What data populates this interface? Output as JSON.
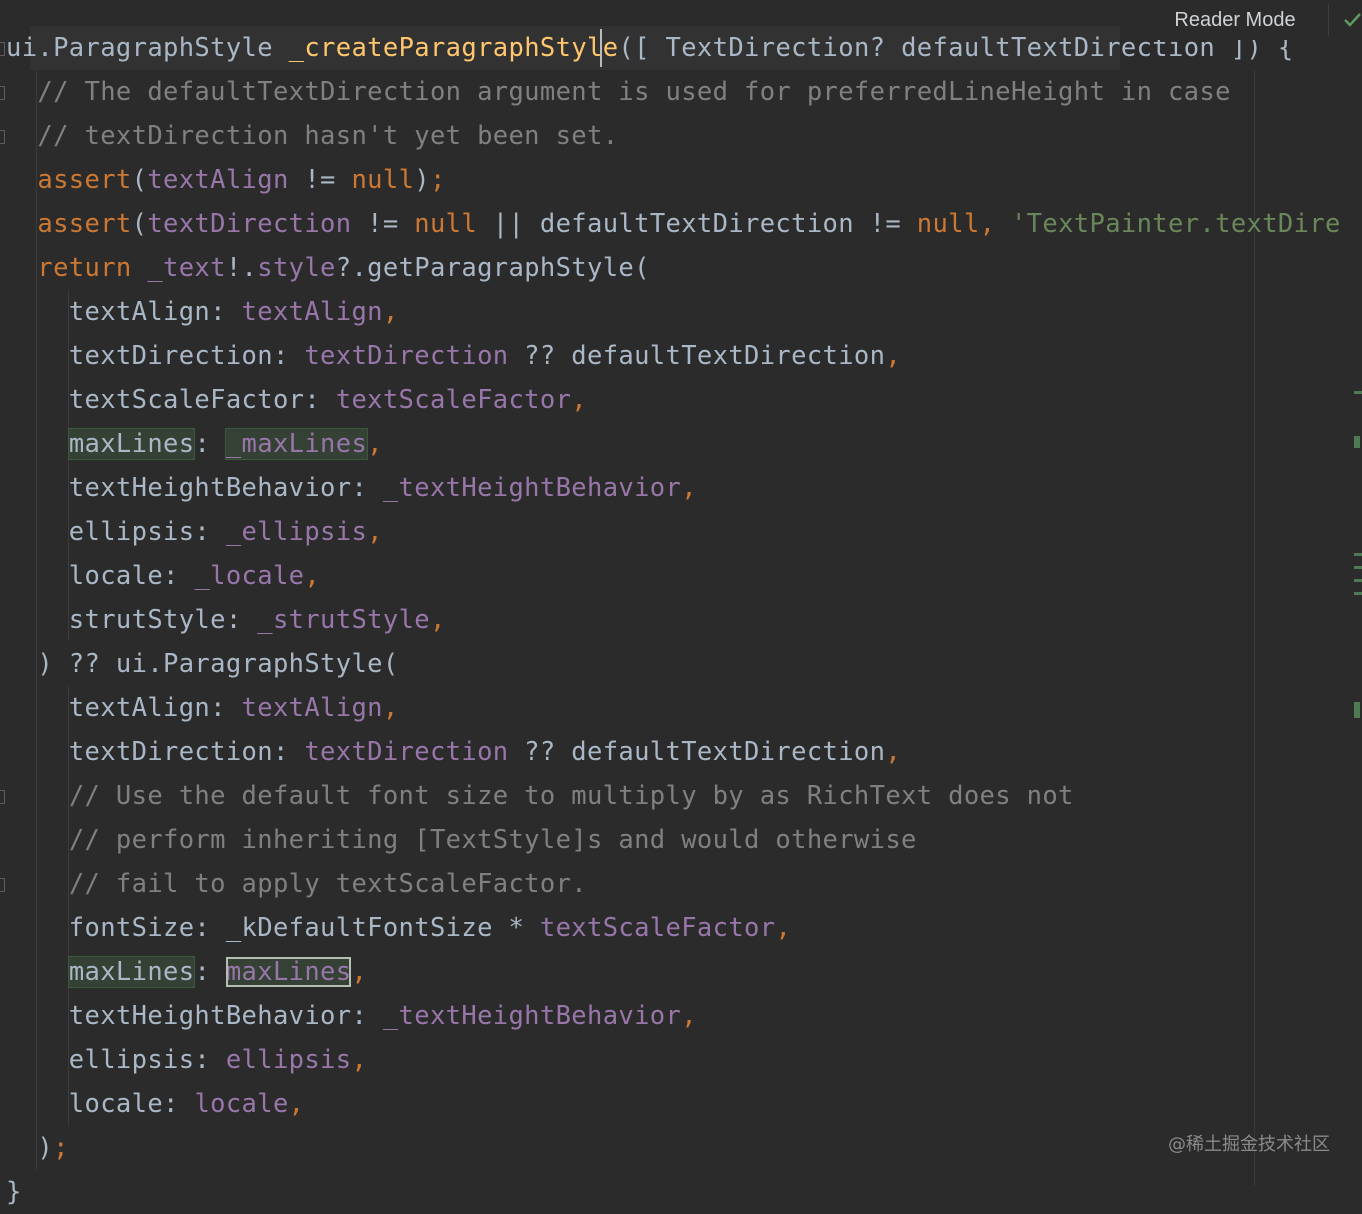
{
  "header": {
    "reader_mode_label": "Reader Mode"
  },
  "watermark": "@稀土掘金技术社区",
  "code_lines": [
    [
      [
        "default",
        "ui.ParagraphStyle "
      ],
      [
        "method",
        "_createParagraphSt"
      ],
      [
        "method",
        "yle"
      ],
      [
        "default",
        "([ TextDirection? defaultTextDirection ]) {"
      ]
    ],
    [
      [
        "default",
        "  "
      ],
      [
        "comment",
        "// The defaultTextDirection argument is used for preferredLineHeight in case"
      ]
    ],
    [
      [
        "default",
        "  "
      ],
      [
        "comment",
        "// textDirection hasn't yet been set."
      ]
    ],
    [
      [
        "default",
        "  "
      ],
      [
        "keyword",
        "assert"
      ],
      [
        "default",
        "("
      ],
      [
        "field",
        "textAlign"
      ],
      [
        "default",
        " != "
      ],
      [
        "keyword",
        "null"
      ],
      [
        "default",
        ")"
      ],
      [
        "punct",
        ";"
      ]
    ],
    [
      [
        "default",
        "  "
      ],
      [
        "keyword",
        "assert"
      ],
      [
        "default",
        "("
      ],
      [
        "field",
        "textDirection"
      ],
      [
        "default",
        " != "
      ],
      [
        "keyword",
        "null"
      ],
      [
        "default",
        " || defaultTextDirection != "
      ],
      [
        "keyword",
        "null"
      ],
      [
        "punct",
        ","
      ],
      [
        "default",
        " "
      ],
      [
        "string",
        "'TextPainter.textDire"
      ]
    ],
    [
      [
        "default",
        "  "
      ],
      [
        "keyword",
        "return"
      ],
      [
        "default",
        " "
      ],
      [
        "field",
        "_text"
      ],
      [
        "default",
        "!."
      ],
      [
        "field",
        "style"
      ],
      [
        "default",
        "?.getParagraphStyle("
      ]
    ],
    [
      [
        "default",
        "    textAlign: "
      ],
      [
        "field",
        "textAlign"
      ],
      [
        "punct",
        ","
      ]
    ],
    [
      [
        "default",
        "    textDirection: "
      ],
      [
        "field",
        "textDirection"
      ],
      [
        "default",
        " ?? defaultTextDirection"
      ],
      [
        "punct",
        ","
      ]
    ],
    [
      [
        "default",
        "    textScaleFactor: "
      ],
      [
        "field",
        "textScaleFactor"
      ],
      [
        "punct",
        ","
      ]
    ],
    [
      [
        "default",
        "    "
      ],
      [
        "default hl-green",
        "maxLines"
      ],
      [
        "default",
        ": "
      ],
      [
        "field hl-green",
        "_maxLines"
      ],
      [
        "punct",
        ","
      ]
    ],
    [
      [
        "default",
        "    textHeightBehavior: "
      ],
      [
        "field",
        "_textHeightBehavior"
      ],
      [
        "punct",
        ","
      ]
    ],
    [
      [
        "default",
        "    ellipsis: "
      ],
      [
        "field",
        "_ellipsis"
      ],
      [
        "punct",
        ","
      ]
    ],
    [
      [
        "default",
        "    locale: "
      ],
      [
        "field",
        "_locale"
      ],
      [
        "punct",
        ","
      ]
    ],
    [
      [
        "default",
        "    strutStyle: "
      ],
      [
        "field",
        "_strutStyle"
      ],
      [
        "punct",
        ","
      ]
    ],
    [
      [
        "default",
        "  ) ?? ui.ParagraphStyle("
      ]
    ],
    [
      [
        "default",
        "    textAlign: "
      ],
      [
        "field",
        "textAlign"
      ],
      [
        "punct",
        ","
      ]
    ],
    [
      [
        "default",
        "    textDirection: "
      ],
      [
        "field",
        "textDirection"
      ],
      [
        "default",
        " ?? defaultTextDirection"
      ],
      [
        "punct",
        ","
      ]
    ],
    [
      [
        "default",
        "    "
      ],
      [
        "comment",
        "// Use the default font size to multiply by as RichText does not"
      ]
    ],
    [
      [
        "default",
        "    "
      ],
      [
        "comment",
        "// perform inheriting [TextStyle]s and would otherwise"
      ]
    ],
    [
      [
        "default",
        "    "
      ],
      [
        "comment",
        "// fail to apply textScaleFactor."
      ]
    ],
    [
      [
        "default",
        "    fontSize: _kDefaultFontSize * "
      ],
      [
        "field",
        "textScaleFactor"
      ],
      [
        "punct",
        ","
      ]
    ],
    [
      [
        "default",
        "    "
      ],
      [
        "default hl-green",
        "maxLines"
      ],
      [
        "default",
        ": "
      ],
      [
        "field hl-box",
        "maxLines"
      ],
      [
        "punct",
        ","
      ]
    ],
    [
      [
        "default",
        "    textHeightBehavior: "
      ],
      [
        "field",
        "_textHeightBehavior"
      ],
      [
        "punct",
        ","
      ]
    ],
    [
      [
        "default",
        "    ellipsis: "
      ],
      [
        "field",
        "ellipsis"
      ],
      [
        "punct",
        ","
      ]
    ],
    [
      [
        "default",
        "    locale: "
      ],
      [
        "field",
        "locale"
      ],
      [
        "punct",
        ","
      ]
    ],
    [
      [
        "default",
        "  )"
      ],
      [
        "punct",
        ";"
      ]
    ],
    [
      [
        "default",
        "}"
      ]
    ]
  ]
}
